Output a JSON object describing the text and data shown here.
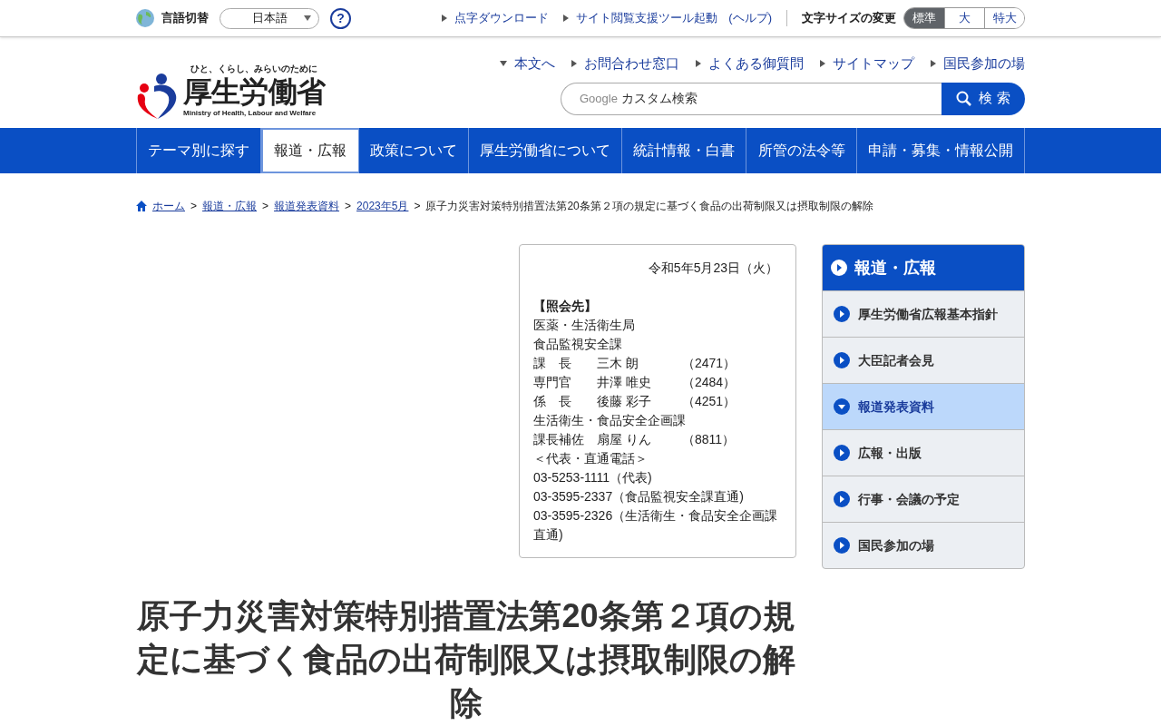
{
  "top_bar": {
    "language_label": "言語切替",
    "language_select": {
      "value": "日本語"
    },
    "help_button": "?",
    "links": [
      {
        "label": "点字ダウンロード"
      },
      {
        "label": "サイト閲覧支援ツール起動"
      }
    ],
    "help_link": "(ヘルプ)",
    "font_size_label": "文字サイズの変更",
    "font_sizes": [
      {
        "label": "標準",
        "selected": true
      },
      {
        "label": "大",
        "selected": false
      },
      {
        "label": "特大",
        "selected": false
      }
    ]
  },
  "header": {
    "tagline": "ひと、くらし、みらいのために",
    "logo_text": "厚生労働省",
    "logo_subtext": "Ministry of Health, Labour and Welfare",
    "links": [
      {
        "label": "本文へ",
        "kind": "down"
      },
      {
        "label": "お問合わせ窓口",
        "kind": "right"
      },
      {
        "label": "よくある御質問",
        "kind": "right"
      },
      {
        "label": "サイトマップ",
        "kind": "right"
      },
      {
        "label": "国民参加の場",
        "kind": "right"
      }
    ],
    "search": {
      "brand": "Google",
      "placeholder": "カスタム検索",
      "button": "検 索"
    }
  },
  "nav": [
    {
      "label": "テーマ別に探す",
      "selected": false
    },
    {
      "label": "報道・広報",
      "selected": true
    },
    {
      "label": "政策について",
      "selected": false
    },
    {
      "label": "厚生労働省について",
      "selected": false
    },
    {
      "label": "統計情報・白書",
      "selected": false
    },
    {
      "label": "所管の法令等",
      "selected": false
    },
    {
      "label": "申請・募集・情報公開",
      "selected": false
    }
  ],
  "breadcrumb_separator": ">",
  "breadcrumb": [
    {
      "label": "ホーム",
      "kind": "link"
    },
    {
      "label": "報道・広報",
      "kind": "link"
    },
    {
      "label": "報道発表資料",
      "kind": "link"
    },
    {
      "label": "2023年5月",
      "kind": "link"
    },
    {
      "label": "原子力災害対策特別措置法第20条第２項の規定に基づく食品の出荷制限又は摂取制限の解除",
      "kind": "current"
    }
  ],
  "contact": {
    "date": "令和5年5月23日（火）",
    "heading": "【照会先】",
    "lines": [
      {
        "kind": "text",
        "text": "医薬・生活衛生局"
      },
      {
        "kind": "text",
        "text": "食品監視安全課"
      },
      {
        "kind": "person",
        "role": "課　長",
        "name": "三木 朗",
        "ext": "（2471）"
      },
      {
        "kind": "person",
        "role": "専門官",
        "name": "井澤 唯史",
        "ext": "（2484）"
      },
      {
        "kind": "person",
        "role": "係　長",
        "name": "後藤 彩子",
        "ext": "（4251）"
      },
      {
        "kind": "text",
        "text": "生活衛生・食品安全企画課"
      },
      {
        "kind": "person",
        "role": "課長補佐",
        "name": "扇屋 りん",
        "ext": "（8811）"
      },
      {
        "kind": "text",
        "text": "＜代表・直通電話＞"
      },
      {
        "kind": "text",
        "text": "03-5253-1111（代表)"
      },
      {
        "kind": "text",
        "text": "03-3595-2337（食品監視安全課直通)"
      },
      {
        "kind": "text",
        "text": "03-3595-2326（生活衛生・食品安全企画課直通)"
      }
    ]
  },
  "title": "原子力災害対策特別措置法第20条第２項の規定に基づく食品の出荷制限又は摂取制限の解除",
  "sidebar": {
    "heading": "報道・広報",
    "items": [
      {
        "label": "厚生労働省広報基本指針",
        "selected": false
      },
      {
        "label": "大臣記者会見",
        "selected": false
      },
      {
        "label": "報道発表資料",
        "selected": true
      },
      {
        "label": "広報・出版",
        "selected": false
      },
      {
        "label": "行事・会議の予定",
        "selected": false
      },
      {
        "label": "国民参加の場",
        "selected": false
      }
    ]
  }
}
